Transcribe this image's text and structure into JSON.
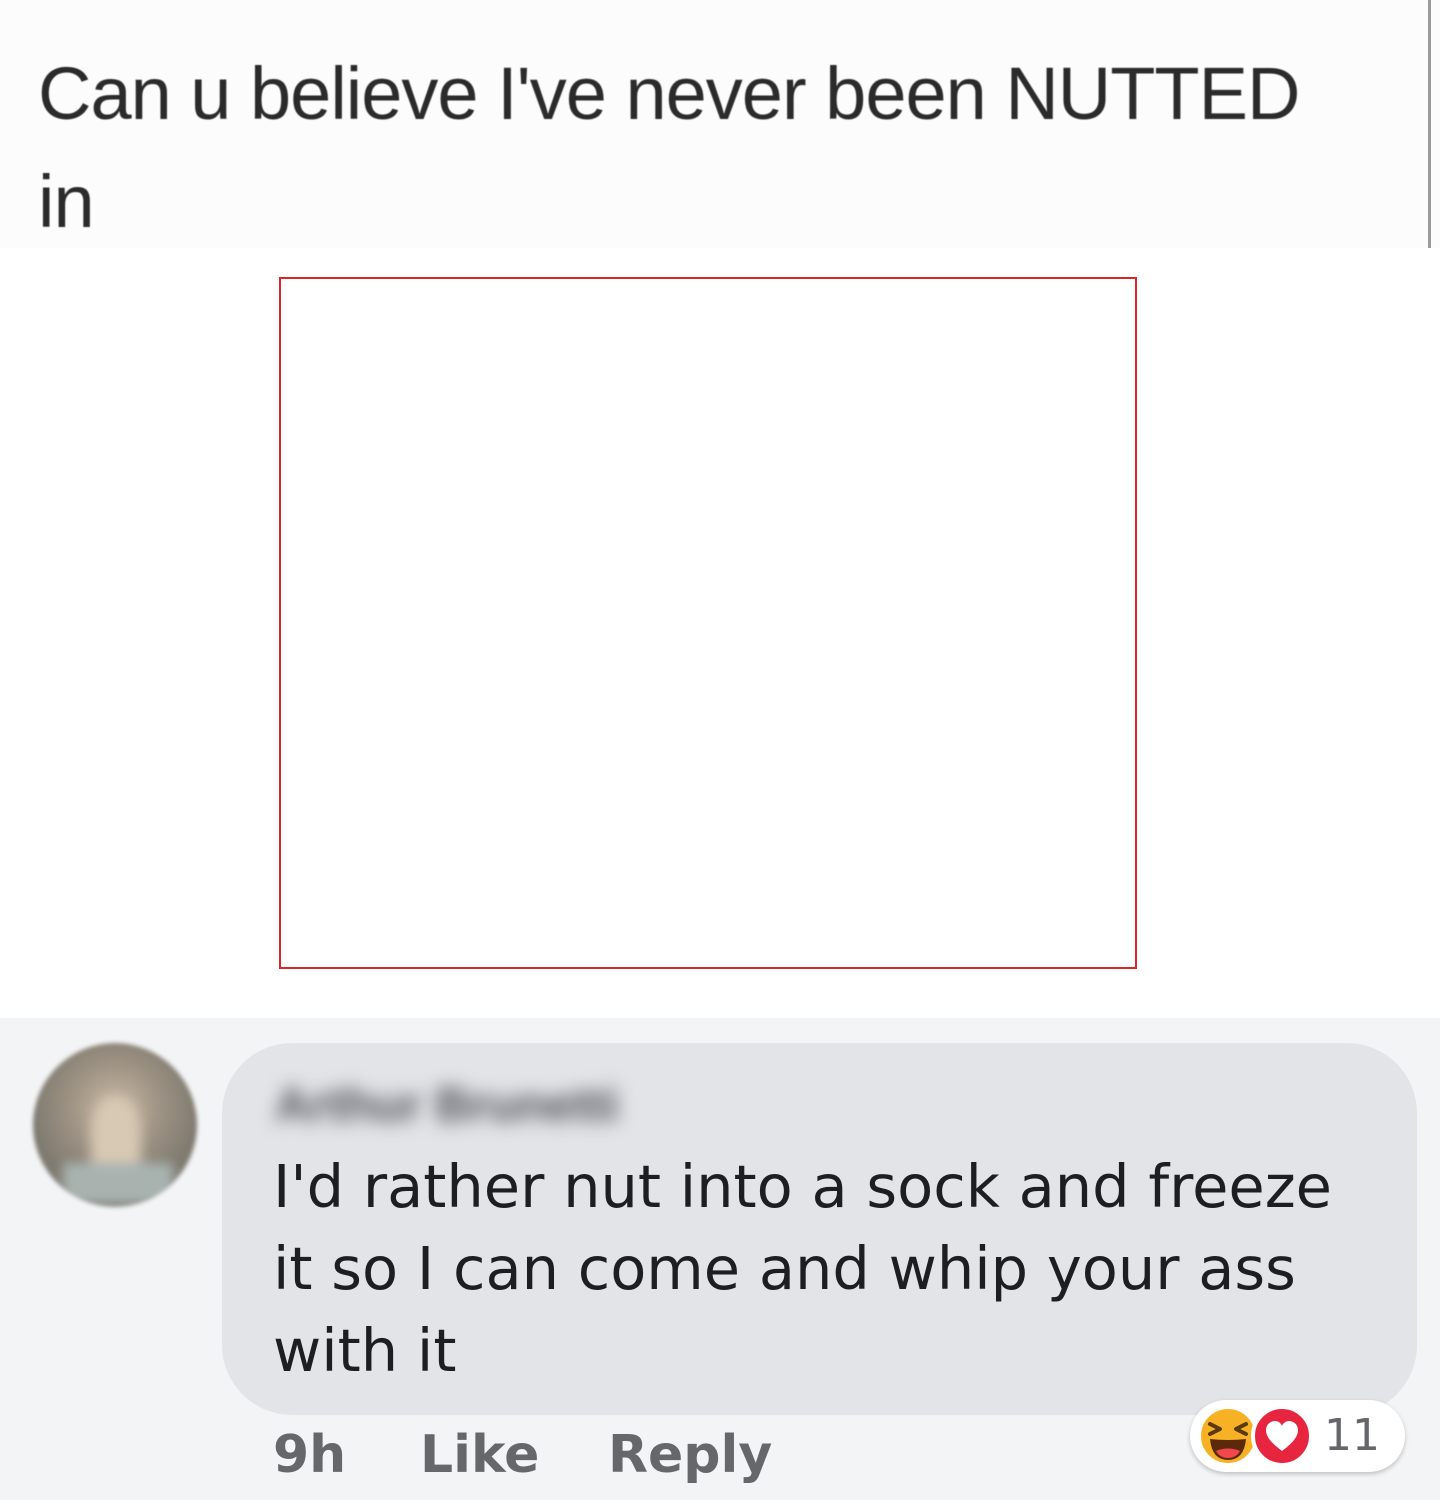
{
  "post": {
    "text_line1": "Can u believe I've never been NUTTED",
    "text_line2": "in"
  },
  "comment": {
    "author_name": "Arthur Brunetti",
    "text": "I'd rather nut into a sock and freeze it so I can come and whip your ass with it",
    "time": "9h",
    "like_label": "Like",
    "reply_label": "Reply",
    "reactions": {
      "icons": [
        "haha-icon",
        "love-icon"
      ],
      "count": "11"
    }
  },
  "colors": {
    "highlight_box": "#d9262b",
    "bubble": "#e3e4e8",
    "meta_text": "#65676b",
    "comment_text": "#1c1e21",
    "love": "#e8253f",
    "haha": "#f7b125"
  }
}
